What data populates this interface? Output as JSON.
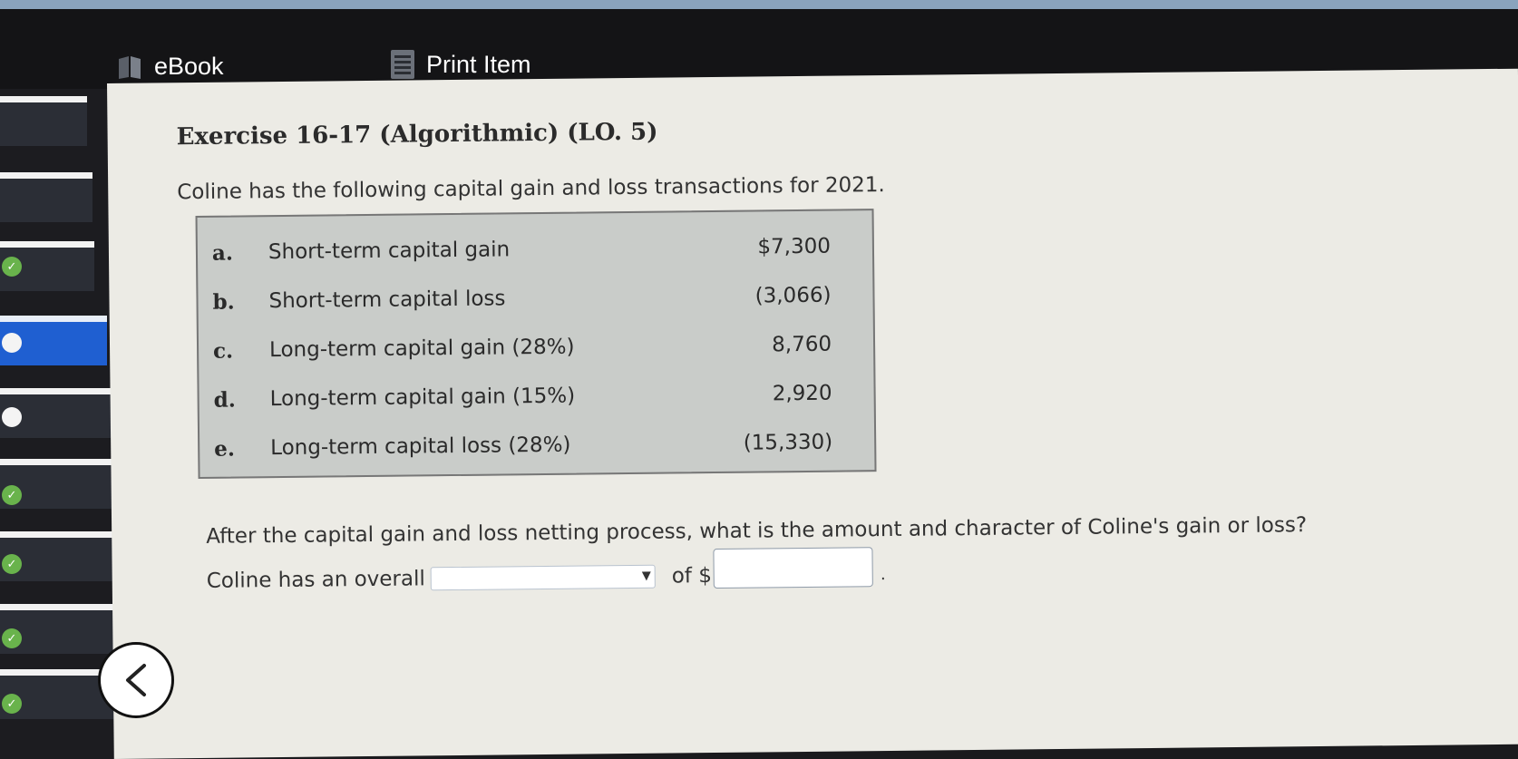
{
  "toolbar": {
    "ebook_label": "eBook",
    "print_label": "Print Item"
  },
  "exercise": {
    "title": "Exercise 16-17 (Algorithmic) (LO. 5)",
    "intro": "Coline has the following capital gain and loss transactions for 2021.",
    "transactions": [
      {
        "letter": "a.",
        "description": "Short-term capital gain",
        "amount": "$7,300"
      },
      {
        "letter": "b.",
        "description": "Short-term capital loss",
        "amount": "(3,066)"
      },
      {
        "letter": "c.",
        "description": "Long-term capital gain (28%)",
        "amount": "8,760"
      },
      {
        "letter": "d.",
        "description": "Long-term capital gain (15%)",
        "amount": "2,920"
      },
      {
        "letter": "e.",
        "description": "Long-term capital loss (28%)",
        "amount": "(15,330)"
      }
    ],
    "question": "After the capital gain and loss netting process, what is the amount and character of Coline's gain or loss?",
    "answer_prefix": "Coline has an overall",
    "answer_select_value": "",
    "answer_of_label": "of $",
    "answer_amount_value": "",
    "answer_suffix": "."
  },
  "colors": {
    "accent_active": "#1f5fd1",
    "status_done": "#69b34c"
  }
}
